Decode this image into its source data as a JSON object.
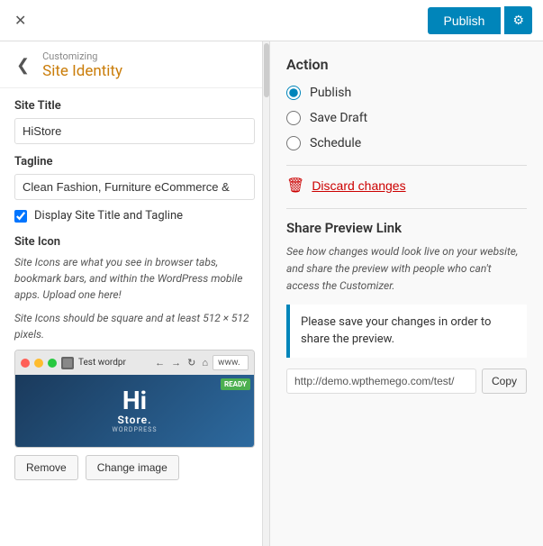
{
  "topbar": {
    "close_label": "✕",
    "publish_label": "Publish",
    "settings_icon": "⚙"
  },
  "left": {
    "breadcrumb": {
      "back_icon": "❮",
      "customizing_label": "Customizing",
      "section_title": "Site Identity"
    },
    "site_title": {
      "label": "Site Title",
      "value": "HiStore",
      "placeholder": "HiStore"
    },
    "tagline": {
      "label": "Tagline",
      "value": "Clean Fashion, Furniture eCommerce &",
      "placeholder": ""
    },
    "display_checkbox": {
      "label": "Display Site Title and Tagline",
      "checked": true
    },
    "site_icon": {
      "label": "Site Icon",
      "desc1": "Site Icons are what you see in browser tabs, bookmark bars, and within the WordPress mobile apps. Upload one here!",
      "desc2": "Site Icons should be square and at least 512 × 512 pixels.",
      "browser_tab_text": "Test wordpr",
      "address_bar": "www.",
      "store_badge": "READY",
      "store_hi": "Hi",
      "store_name": "Store.",
      "store_wp": "WORDPRESS",
      "remove_btn": "Remove",
      "change_btn": "Change image"
    }
  },
  "right": {
    "action_title": "Action",
    "radio_options": [
      {
        "id": "opt-publish",
        "label": "Publish",
        "checked": true
      },
      {
        "id": "opt-draft",
        "label": "Save Draft",
        "checked": false
      },
      {
        "id": "opt-schedule",
        "label": "Schedule",
        "checked": false
      }
    ],
    "discard_label": "Discard changes",
    "share_preview_title": "Share Preview Link",
    "share_preview_desc": "See how changes would look live on your website, and share the preview with people who can't access the Customizer.",
    "info_box": "Please save your changes in order to share the preview.",
    "url_value": "http://demo.wpthemego.com/test/",
    "copy_label": "Copy"
  }
}
